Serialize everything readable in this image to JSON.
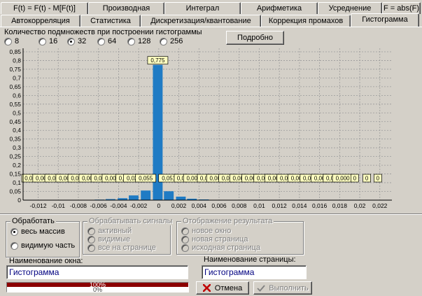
{
  "tabs_row1": [
    "F(t) = F(t) - M[F(t)]",
    "Производная",
    "Интеграл",
    "Арифметика",
    "Усреднение",
    "F = abs(F)"
  ],
  "tabs_row2": [
    "Автокорреляция",
    "Статистика",
    "Дискретизация/квантование",
    "Коррекция промахов",
    "Гистограмма"
  ],
  "active_tab": "Гистограмма",
  "bins": {
    "title": "Количество подмножеств при построении гистограммы",
    "options": [
      "8",
      "16",
      "32",
      "64",
      "128",
      "256"
    ],
    "selected": "32"
  },
  "details_button": "Подробно",
  "chart_data": {
    "type": "bar",
    "x_ticks": [
      "-0,012",
      "-0,01",
      "-0,008",
      "-0,006",
      "-0,004",
      "-0,002",
      "0",
      "0,002",
      "0,004",
      "0,006",
      "0,008",
      "0,01",
      "0,012",
      "0,014",
      "0,016",
      "0,018",
      "0,02",
      "0,022"
    ],
    "xlim": [
      -0.0135,
      0.0232
    ],
    "y_ticks": [
      "0",
      "0,05",
      "0,1",
      "0,15",
      "0,2",
      "0,25",
      "0,3",
      "0,35",
      "0,4",
      "0,45",
      "0,5",
      "0,55",
      "0,6",
      "0,65",
      "0,7",
      "0,75",
      "0,8",
      "0,85"
    ],
    "ylim": [
      0,
      0.87
    ],
    "grid": true,
    "bars": [
      {
        "x": -0.0128,
        "value": 0.0,
        "label": "0,00"
      },
      {
        "x": -0.0117,
        "value": 0.0,
        "label": "0,00"
      },
      {
        "x": -0.0105,
        "value": 0.0,
        "label": "0,00"
      },
      {
        "x": -0.0094,
        "value": 0.0,
        "label": "0,00"
      },
      {
        "x": -0.0082,
        "value": 0.0,
        "label": "0,00"
      },
      {
        "x": -0.0071,
        "value": 0.0,
        "label": "0,00"
      },
      {
        "x": -0.0059,
        "value": 0.003,
        "label": "0,00"
      },
      {
        "x": -0.0048,
        "value": 0.006,
        "label": "0,00"
      },
      {
        "x": -0.0036,
        "value": 0.011,
        "label": "0,0"
      },
      {
        "x": -0.0025,
        "value": 0.027,
        "label": "0,027"
      },
      {
        "x": -0.0013,
        "value": 0.055,
        "label": "0,055"
      },
      {
        "x": -0.0001,
        "value": 0.775,
        "label": "0,775"
      },
      {
        "x": 0.001,
        "value": 0.051,
        "label": "0,051"
      },
      {
        "x": 0.0022,
        "value": 0.02,
        "label": "0,0"
      },
      {
        "x": 0.0033,
        "value": 0.008,
        "label": "0,00"
      },
      {
        "x": 0.0045,
        "value": 0.004,
        "label": "0,0"
      },
      {
        "x": 0.0056,
        "value": 0.002,
        "label": "0,00"
      },
      {
        "x": 0.0068,
        "value": 0.001,
        "label": "0,00"
      },
      {
        "x": 0.0079,
        "value": 0.0,
        "label": "0,00"
      },
      {
        "x": 0.0091,
        "value": 0.0,
        "label": "0,00"
      },
      {
        "x": 0.0103,
        "value": 0.0,
        "label": "0,00"
      },
      {
        "x": 0.0114,
        "value": 0.0,
        "label": "0,00"
      },
      {
        "x": 0.0126,
        "value": 0.0,
        "label": "0,00"
      },
      {
        "x": 0.0137,
        "value": 0.0,
        "label": "0,00"
      },
      {
        "x": 0.0149,
        "value": 0.0,
        "label": "0,00"
      },
      {
        "x": 0.016,
        "value": 0.0,
        "label": "0,00"
      },
      {
        "x": 0.0172,
        "value": 0.0,
        "label": "0,00"
      },
      {
        "x": 0.0183,
        "value": 0.0,
        "label": "0,000"
      },
      {
        "x": 0.0195,
        "value": 0.0,
        "label": "0"
      },
      {
        "x": 0.0207,
        "value": 0.0,
        "label": "0"
      },
      {
        "x": 0.0218,
        "value": 0.0,
        "label": "0"
      }
    ],
    "bar_color": "#1f7bc4",
    "label_bg": "#ffffc0"
  },
  "process": {
    "title": "Обработать",
    "options": [
      "весь массив",
      "видимую часть"
    ],
    "selected": "весь массив"
  },
  "signals": {
    "title": "Обрабатывать сигналы",
    "options": [
      "активный",
      "видимые",
      "все на странице"
    ]
  },
  "display": {
    "title": "Отображение результата",
    "options": [
      "новое окно",
      "новая страница",
      "исходная страница"
    ]
  },
  "window_name": {
    "label": "Наименование окна:",
    "value": "Гистограмма"
  },
  "page_name": {
    "label": "Наименование страницы:",
    "value": "Гистограмма"
  },
  "progress": {
    "top_text": "100%",
    "bottom_text": "0%",
    "value": 1.0
  },
  "buttons": {
    "cancel": "Отмена",
    "run": "Выполнить"
  }
}
